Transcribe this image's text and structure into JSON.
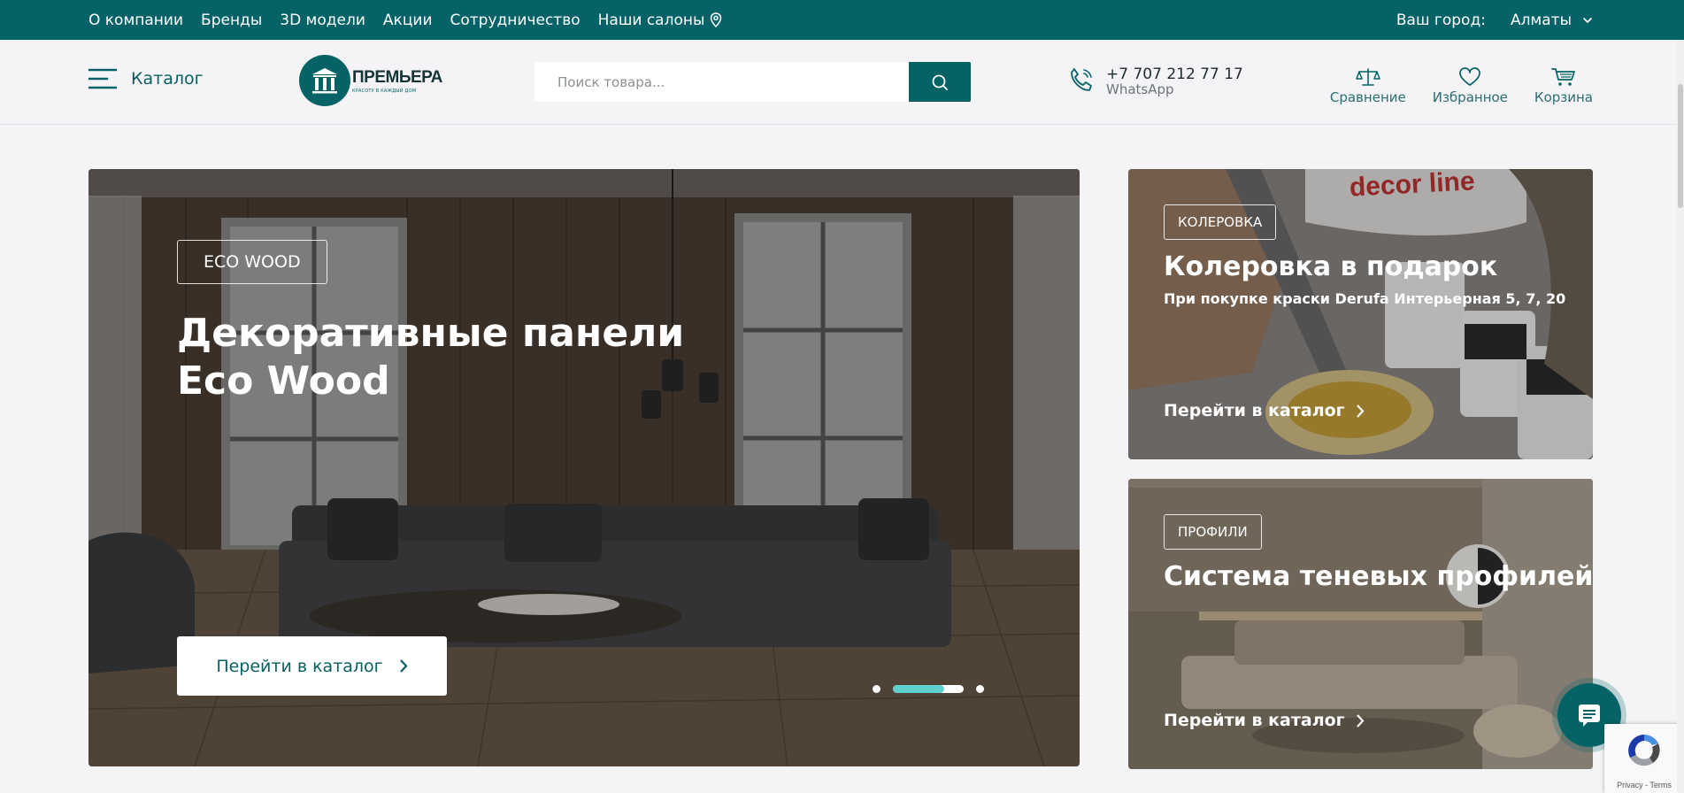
{
  "topbar": {
    "nav": [
      "О компании",
      "Бренды",
      "3D модели",
      "Акции",
      "Сотрудничество",
      "Наши салоны"
    ],
    "city_label": "Ваш город:",
    "city_value": "Алматы"
  },
  "header": {
    "catalog_label": "Каталог",
    "logo_name": "ПРЕМЬЕРА",
    "logo_slogan": "КРАСОТУ В КАЖДЫЙ ДОМ",
    "search_placeholder": "Поиск товара...",
    "phone": "+7 707 212 77 17",
    "phone_sub": "WhatsApp",
    "compare_label": "Сравнение",
    "favorites_label": "Избранное",
    "cart_label": "Корзина"
  },
  "hero": {
    "tag": "ECO WOOD",
    "title_line1": "Декоративные панели",
    "title_line2": "Eco Wood",
    "button_label": "Перейти в каталог",
    "slides_total": 3,
    "active_slide": 2,
    "active_progress": 0.73
  },
  "promos": [
    {
      "tag": "КОЛЕРОВКА",
      "title": "Колеровка в подарок",
      "subtitle": "При покупке краски Derufa Интерьерная 5, 7, 20",
      "link": "Перейти в каталог"
    },
    {
      "tag": "ПРОФИЛИ",
      "title": "Система теневых профилей",
      "subtitle": "",
      "link": "Перейти в каталог"
    }
  ],
  "recaptcha": {
    "terms": "Privacy - Terms"
  },
  "colors": {
    "brand": "#056367",
    "accent": "#5fd0d0"
  }
}
